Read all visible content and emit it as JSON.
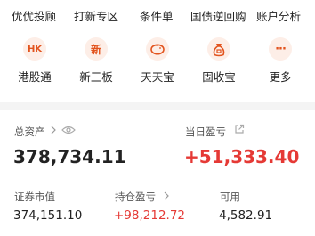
{
  "top_menu": [
    "优优投顾",
    "打新专区",
    "条件单",
    "国债逆回购",
    "账户分析"
  ],
  "services": [
    {
      "label": "港股通",
      "icon": "hk-icon",
      "icon_text": "HK"
    },
    {
      "label": "新三板",
      "icon": "xin-icon",
      "icon_text": "新"
    },
    {
      "label": "天天宝",
      "icon": "piggy-bank-icon"
    },
    {
      "label": "固收宝",
      "icon": "money-bag-icon"
    },
    {
      "label": "更多",
      "icon": "more-icon",
      "icon_text": "···"
    }
  ],
  "assets": {
    "total_label": "总资产",
    "total_value": "378,734.11",
    "daily_pl_label": "当日盈亏",
    "daily_pl_value": "+51,333.40",
    "market_value_label": "证券市值",
    "market_value": "374,151.10",
    "position_pl_label": "持仓盈亏",
    "position_pl_value": "+98,212.72",
    "available_label": "可用",
    "available_value": "4,582.91"
  },
  "colors": {
    "accent": "#e53935",
    "icon_bg": "#fdeee7",
    "icon_fg": "#e2531d"
  }
}
